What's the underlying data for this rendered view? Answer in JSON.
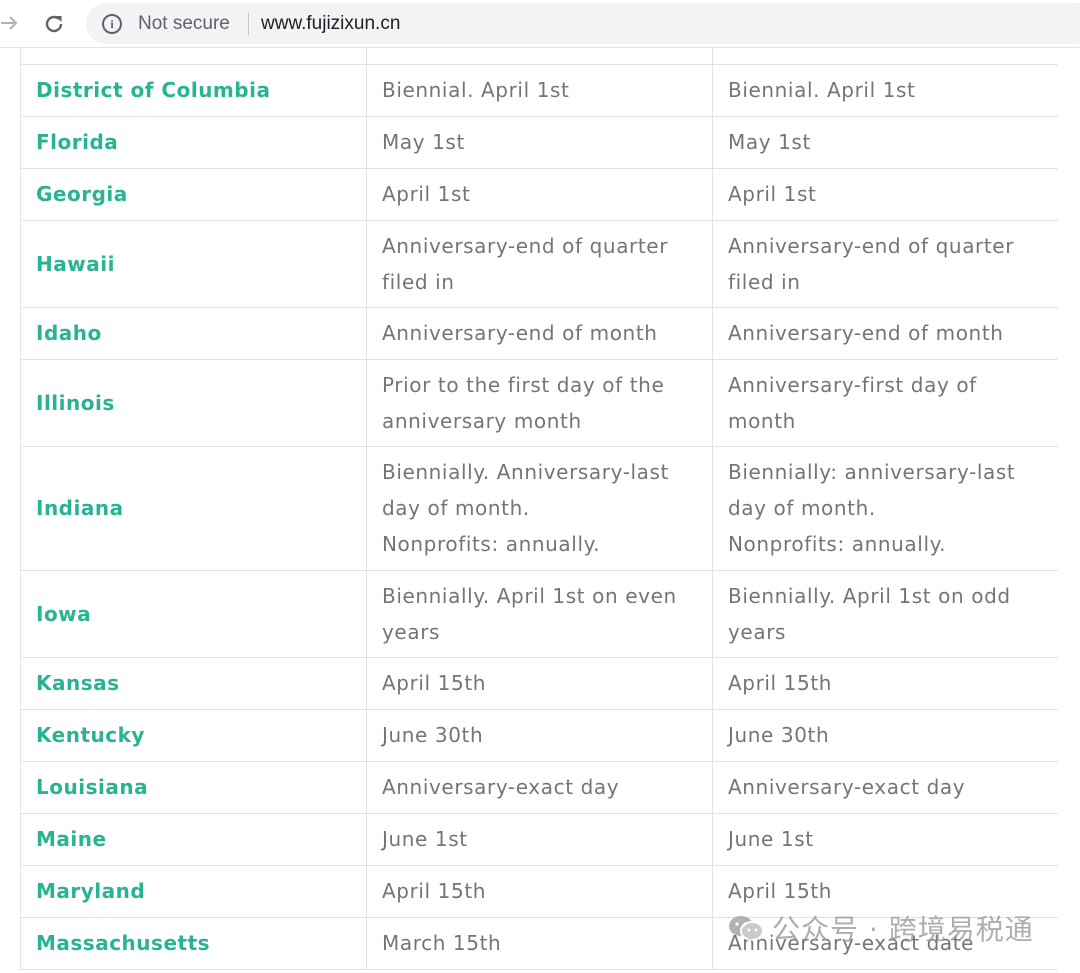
{
  "browser": {
    "security_label": "Not secure",
    "url": "www.fujizixun.cn"
  },
  "table": {
    "rows": [
      {
        "state": "District of Columbia",
        "col2": [
          "Biennial. April 1st"
        ],
        "col3": [
          "Biennial. April 1st"
        ]
      },
      {
        "state": "Florida",
        "col2": [
          "May 1st"
        ],
        "col3": [
          "May 1st"
        ]
      },
      {
        "state": "Georgia",
        "col2": [
          "April 1st"
        ],
        "col3": [
          "April 1st"
        ]
      },
      {
        "state": "Hawaii",
        "col2": [
          "Anniversary-end of quarter",
          "filed in"
        ],
        "col3": [
          "Anniversary-end of quarter",
          "filed in"
        ]
      },
      {
        "state": "Idaho",
        "col2": [
          "Anniversary-end of month"
        ],
        "col3": [
          "Anniversary-end of month"
        ]
      },
      {
        "state": "Illinois",
        "col2": [
          "Prior to the first day of the",
          "anniversary month"
        ],
        "col3": [
          "Anniversary-first day of",
          "month"
        ]
      },
      {
        "state": "Indiana",
        "col2": [
          "Biennially. Anniversary-last",
          "day of month.",
          "Nonprofits: annually."
        ],
        "col3": [
          "Biennially: anniversary-last",
          "day of month.",
          "Nonprofits: annually."
        ]
      },
      {
        "state": "Iowa",
        "col2": [
          "Biennially. April 1st on even",
          "years"
        ],
        "col3": [
          "Biennially. April 1st on odd",
          "years"
        ]
      },
      {
        "state": "Kansas",
        "col2": [
          "April 15th"
        ],
        "col3": [
          "April 15th"
        ]
      },
      {
        "state": "Kentucky",
        "col2": [
          "June 30th"
        ],
        "col3": [
          "June 30th"
        ]
      },
      {
        "state": "Louisiana",
        "col2": [
          "Anniversary-exact day"
        ],
        "col3": [
          "Anniversary-exact day"
        ]
      },
      {
        "state": "Maine",
        "col2": [
          "June 1st"
        ],
        "col3": [
          "June 1st"
        ]
      },
      {
        "state": "Maryland",
        "col2": [
          "April 15th"
        ],
        "col3": [
          "April 15th"
        ]
      },
      {
        "state": "Massachusetts",
        "col2": [
          "March 15th"
        ],
        "col3": [
          "Anniversary-exact date"
        ]
      }
    ]
  },
  "watermark": {
    "text": "公众号 · 跨境易税通",
    "icon": "wechat-icon"
  },
  "colors": {
    "state_link": "#28b493",
    "cell_text": "#757575",
    "border": "#e1e1e1"
  }
}
